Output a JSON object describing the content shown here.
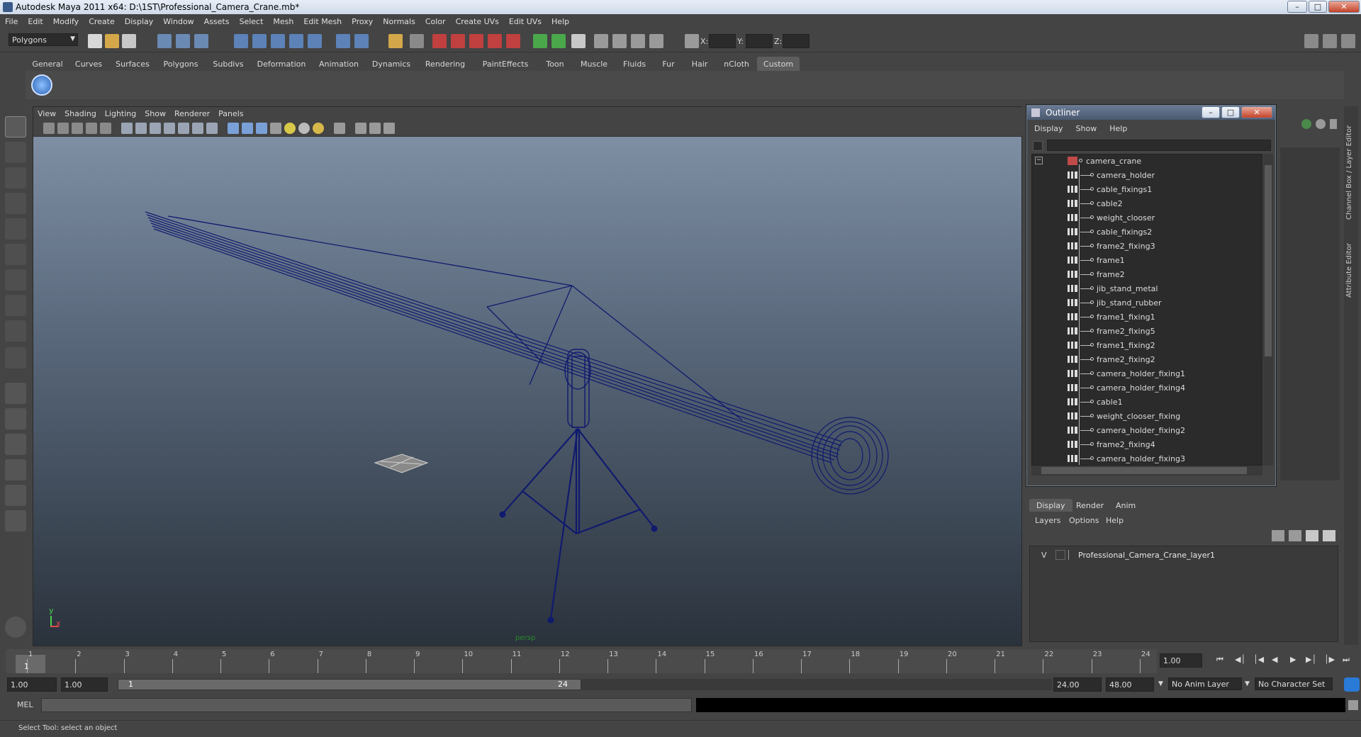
{
  "window": {
    "title": "Autodesk Maya 2011 x64: D:\\1ST\\Professional_Camera_Crane.mb*"
  },
  "menubar": [
    "File",
    "Edit",
    "Modify",
    "Create",
    "Display",
    "Window",
    "Assets",
    "Select",
    "Mesh",
    "Edit Mesh",
    "Proxy",
    "Normals",
    "Color",
    "Create UVs",
    "Edit UVs",
    "Help"
  ],
  "statusline": {
    "menuset": "Polygons",
    "x_label": "X:",
    "y_label": "Y:",
    "z_label": "Z:"
  },
  "shelf": {
    "tabs": [
      "General",
      "Curves",
      "Surfaces",
      "Polygons",
      "Subdivs",
      "Deformation",
      "Animation",
      "Dynamics",
      "Rendering",
      "PaintEffects",
      "Toon",
      "Muscle",
      "Fluids",
      "Fur",
      "Hair",
      "nCloth",
      "Custom"
    ],
    "active_tab": "Custom"
  },
  "viewport": {
    "menus": [
      "View",
      "Shading",
      "Lighting",
      "Show",
      "Renderer",
      "Panels"
    ],
    "camera_label": "persp",
    "axis": {
      "y": "y",
      "x": "x",
      "z": "z"
    },
    "colors": {
      "wireframe": "#101a6e",
      "bg_top": "#7e8ea3",
      "bg_bottom": "#2a323c"
    }
  },
  "outliner": {
    "title": "Outliner",
    "menus": [
      "Display",
      "Show",
      "Help"
    ],
    "root": "camera_crane",
    "items": [
      "camera_holder",
      "cable_fixings1",
      "cable2",
      "weight_clooser",
      "cable_fixings2",
      "frame2_fixing3",
      "frame1",
      "frame2",
      "jib_stand_metal",
      "jib_stand_rubber",
      "frame1_fixing1",
      "frame2_fixing5",
      "frame1_fixing2",
      "frame2_fixing2",
      "camera_holder_fixing1",
      "camera_holder_fixing4",
      "cable1",
      "weight_clooser_fixing",
      "camera_holder_fixing2",
      "frame2_fixing4",
      "camera_holder_fixing3"
    ]
  },
  "sidebar_tabs": [
    "Channel Box / Layer Editor",
    "Attribute Editor"
  ],
  "layer_editor": {
    "tabs": [
      "Display",
      "Render",
      "Anim"
    ],
    "active_tab": "Display",
    "menus": [
      "Layers",
      "Options",
      "Help"
    ],
    "layers": [
      {
        "visible": "V",
        "name": "Professional_Camera_Crane_layer1"
      }
    ]
  },
  "timeline": {
    "ticks": [
      "1",
      "2",
      "3",
      "4",
      "5",
      "6",
      "7",
      "8",
      "9",
      "10",
      "11",
      "12",
      "13",
      "14",
      "15",
      "16",
      "17",
      "18",
      "19",
      "20",
      "21",
      "22",
      "23",
      "24"
    ],
    "current_frame": "1",
    "current_time_field": "1.00"
  },
  "range": {
    "start": "1.00",
    "inner_start": "1.00",
    "slider_start": "1",
    "slider_end": "24",
    "end": "24.00",
    "outer_end": "48.00",
    "anim_layer": "No Anim Layer",
    "character_set": "No Character Set"
  },
  "command_line": {
    "label": "MEL",
    "value": ""
  },
  "help_line": {
    "text": "Select Tool: select an object"
  }
}
